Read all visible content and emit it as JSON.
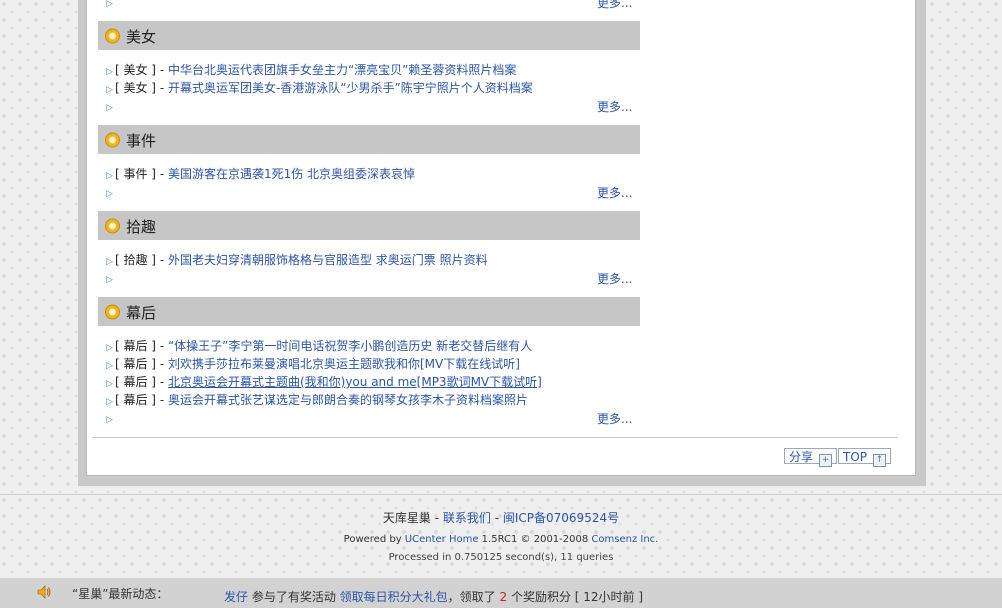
{
  "top_more": "更多...",
  "sections": [
    {
      "title": "美女",
      "items": [
        {
          "cat": "[ 美女 ]",
          "text": "中华台北奥运代表团旗手女垒主力“漂亮宝贝”赖圣蓉资料照片档案"
        },
        {
          "cat": "[ 美女 ]",
          "text": "开幕式奥运军团美女-香港游泳队“少男杀手”陈宇宁照片个人资料档案"
        }
      ],
      "more": "更多..."
    },
    {
      "title": "事件",
      "items": [
        {
          "cat": "[ 事件 ]",
          "text": "美国游客在京遇袭1死1伤 北京奥组委深表哀悼"
        }
      ],
      "more": "更多..."
    },
    {
      "title": "拾趣",
      "items": [
        {
          "cat": "[ 拾趣 ]",
          "text": "外国老夫妇穿清朝服饰格格与官服造型 求奥运门票 照片资料"
        }
      ],
      "more": "更多..."
    },
    {
      "title": "幕后",
      "items": [
        {
          "cat": "[ 幕后 ]",
          "text": "“体操王子”李宁第一时间电话祝贺李小鹏创造历史 新老交替后继有人"
        },
        {
          "cat": "[ 幕后 ]",
          "text": "刘欢携手莎拉布莱曼演唱北京奥运主题歌我和你[MV下载在线试听]"
        },
        {
          "cat": "[ 幕后 ]",
          "text": "北京奥运会开幕式主题曲(我和你)you and me[MP3歌词MV下载试听]"
        },
        {
          "cat": "[ 幕后 ]",
          "text": "奥运会开幕式张艺谋选定与郎朗合奏的钢琴女孩李木子资料档案照片"
        }
      ],
      "more": "更多..."
    }
  ],
  "sep": " - ",
  "buttons": {
    "share": "分享",
    "top": "TOP"
  },
  "footer": {
    "site": "天库星巢",
    "dash": " - ",
    "contact": "联系我们",
    "icp": "闽ICP备07069524号",
    "powered_prefix": "Powered by ",
    "powered_link": "UCenter Home",
    "powered_mid": " 1.5RC1 © 2001-2008 ",
    "company": "Comsenz Inc.",
    "processed": "Processed in 0.750125 second(s), 11 queries"
  },
  "dynamic": {
    "label": "“星巢”最新动态：",
    "user": "发仔",
    "action": " 参与了有奖活动 ",
    "activity": "领取每日积分大礼包",
    "got": "，领取了 ",
    "points": "2",
    "unit": " 个奖励积分  [ ",
    "time": "12小时前",
    "close": " ]"
  }
}
